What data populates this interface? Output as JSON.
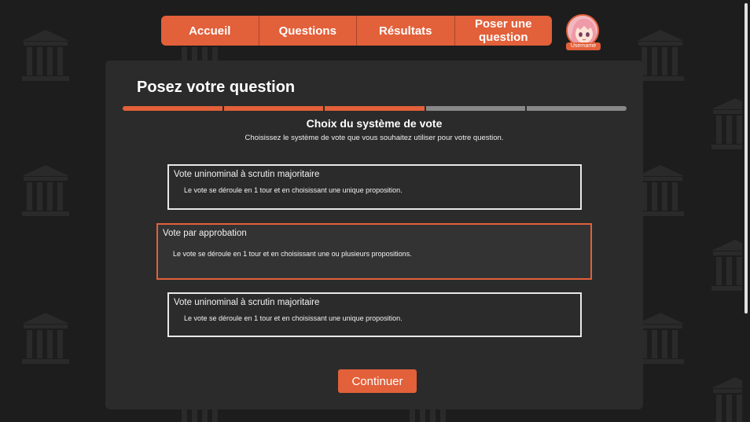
{
  "nav": {
    "items": [
      "Accueil",
      "Questions",
      "Résultats",
      "Poser une question"
    ]
  },
  "user": {
    "name": "Username"
  },
  "page": {
    "title": "Posez votre question",
    "progress": {
      "completed_steps": 3,
      "total_steps": 5
    },
    "step_title": "Choix du système de vote",
    "step_description": "Choisissez le système de vote que vous souhaitez utiliser pour votre question."
  },
  "options": [
    {
      "title": "Vote uninominal à scrutin majoritaire",
      "description": "Le vote se déroule en 1 tour et en choisissant une unique proposition.",
      "selected": false
    },
    {
      "title": "Vote par approbation",
      "description": "Le vote se déroule en 1 tour et en choisissant une ou plusieurs propositions.",
      "selected": true
    },
    {
      "title": "Vote uninominal à scrutin majoritaire",
      "description": "Le vote se déroule en 1 tour et en choisissant une unique proposition.",
      "selected": false
    }
  ],
  "continue_label": "Continuer",
  "colors": {
    "accent": "#e2603a",
    "background": "#1d1d1d",
    "panel": "#2b2b2b"
  }
}
